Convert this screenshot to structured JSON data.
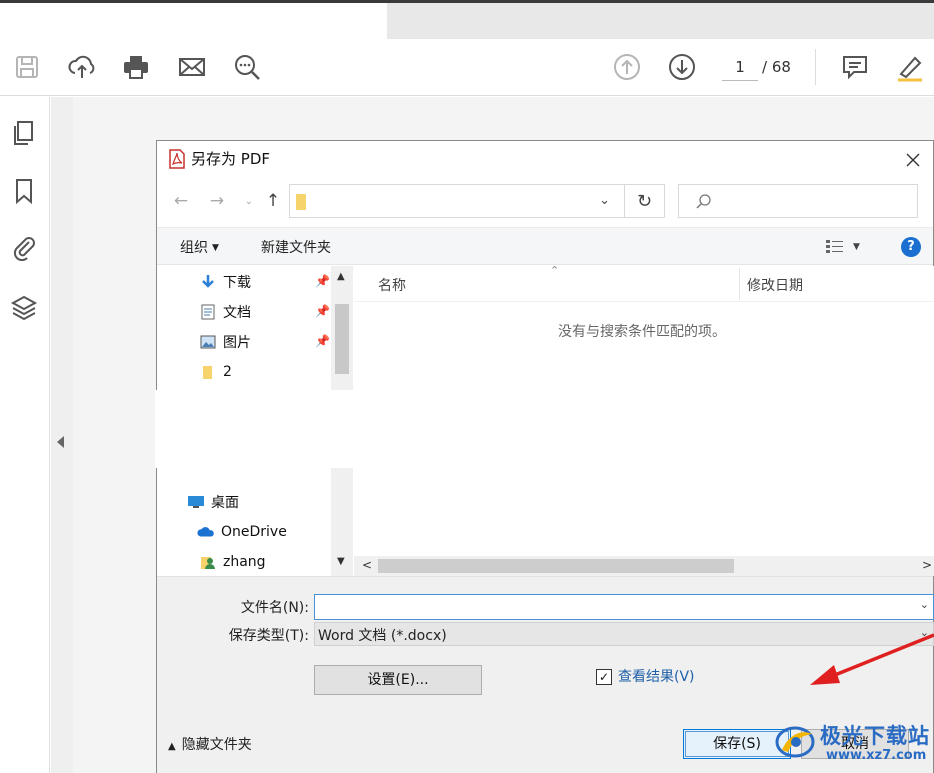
{
  "toolbar": {
    "page_current": "1",
    "page_total": "/ 68"
  },
  "dialog": {
    "title": "另存为 PDF",
    "close_icon": "close-icon",
    "nav": {
      "back_icon": "arrow-left-icon",
      "forward_icon": "arrow-right-icon",
      "up_icon": "arrow-up-icon",
      "refresh_icon": "refresh-icon",
      "search_icon": "search-icon"
    },
    "commands": {
      "organize": "组织",
      "new_folder": "新建文件夹"
    },
    "nav_pane": {
      "items": [
        {
          "label": "下载",
          "icon": "download-icon",
          "pinned": true
        },
        {
          "label": "文档",
          "icon": "document-icon",
          "pinned": true
        },
        {
          "label": "图片",
          "icon": "picture-icon",
          "pinned": true
        },
        {
          "label": "2",
          "icon": "folder-icon",
          "pinned": false
        },
        {
          "label": "桌面",
          "icon": "desktop-icon",
          "pinned": false
        },
        {
          "label": "OneDrive",
          "icon": "cloud-icon",
          "pinned": false
        },
        {
          "label": "zhang",
          "icon": "user-icon",
          "pinned": false
        }
      ]
    },
    "file_list": {
      "col_name": "名称",
      "col_date": "修改日期",
      "empty_message": "没有与搜索条件匹配的项。"
    },
    "filename_label": "文件名(N):",
    "filename_value": "",
    "filetype_label": "保存类型(T):",
    "filetype_value": "Word 文档 (*.docx)",
    "settings_button": "设置(E)...",
    "view_result_label": "查看结果(V)",
    "view_result_checked": "✓",
    "hide_folders": "隐藏文件夹",
    "save_button": "保存(S)",
    "cancel_button": "取消"
  },
  "watermark": {
    "text": "极光下载站",
    "url": "www.xz7.com"
  },
  "colors": {
    "accent": "#0078d7",
    "link": "#1f5fa8",
    "annotation": "#e02020"
  }
}
